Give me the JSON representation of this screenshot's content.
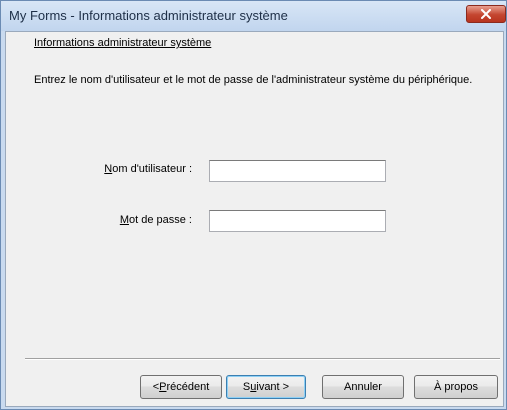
{
  "window": {
    "title": "My Forms - Informations administrateur système"
  },
  "content": {
    "heading": "Informations administrateur système",
    "instructions": "Entrez le nom d'utilisateur et le mot de passe de l'administrateur système du périphérique."
  },
  "form": {
    "username": {
      "label_mnemonic": "N",
      "label_rest": "om d'utilisateur :",
      "value": ""
    },
    "password": {
      "label_mnemonic": "M",
      "label_rest": "ot de passe :",
      "value": ""
    }
  },
  "buttons": {
    "back": {
      "prefix": "< ",
      "mnemonic": "P",
      "rest": "récédent"
    },
    "next": {
      "prefix": "S",
      "mnemonic": "u",
      "rest": "ivant >"
    },
    "cancel": "Annuler",
    "about": "À propos"
  },
  "icons": {
    "close": "close-icon"
  }
}
